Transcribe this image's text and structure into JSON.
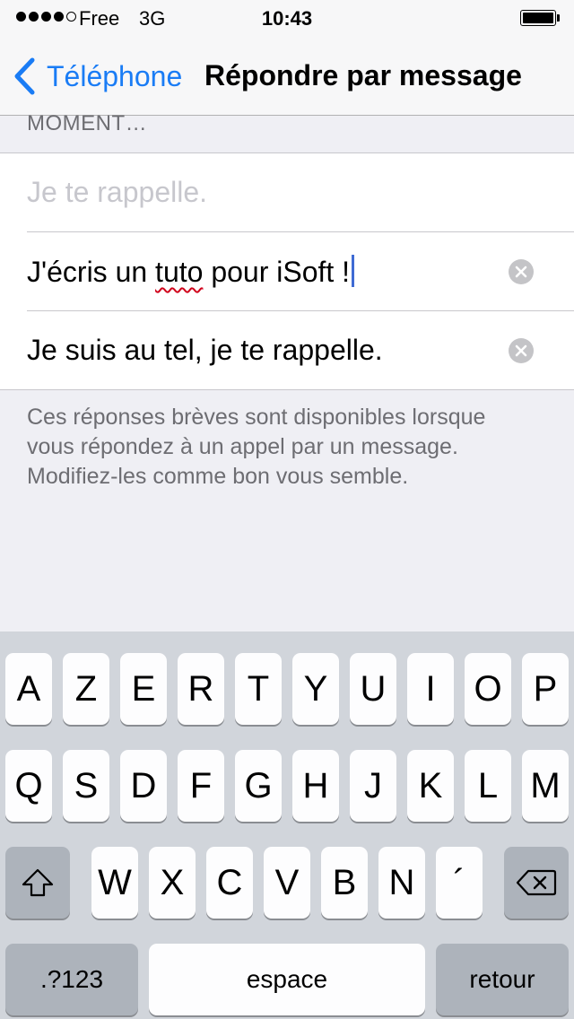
{
  "status_bar": {
    "carrier": "Free",
    "network": "3G",
    "time": "10:43"
  },
  "nav": {
    "back_label": "Téléphone",
    "title": "Répondre par message"
  },
  "section": {
    "header": "MOMENT…"
  },
  "responses": {
    "placeholder": "Je te rappelle.",
    "item1_pre": "J'écris un ",
    "item1_mis": "tuto",
    "item1_post": " pour iSoft !",
    "item2": "Je suis au tel, je te rappelle."
  },
  "footer": "Ces réponses brèves sont disponibles lorsque vous répondez à un appel par un message. Modifiez-les comme bon vous semble.",
  "keyboard": {
    "row1": [
      "A",
      "Z",
      "E",
      "R",
      "T",
      "Y",
      "U",
      "I",
      "O",
      "P"
    ],
    "row2": [
      "Q",
      "S",
      "D",
      "F",
      "G",
      "H",
      "J",
      "K",
      "L",
      "M"
    ],
    "row3": [
      "W",
      "X",
      "C",
      "V",
      "B",
      "N",
      "´"
    ],
    "numbers": ".?123",
    "space": "espace",
    "return": "retour",
    "icons": {
      "shift": "shift-icon",
      "delete": "delete-icon"
    }
  },
  "colors": {
    "accent": "#1a7cf5",
    "background": "#efeff4",
    "keyboard_bg": "#d1d5db"
  }
}
